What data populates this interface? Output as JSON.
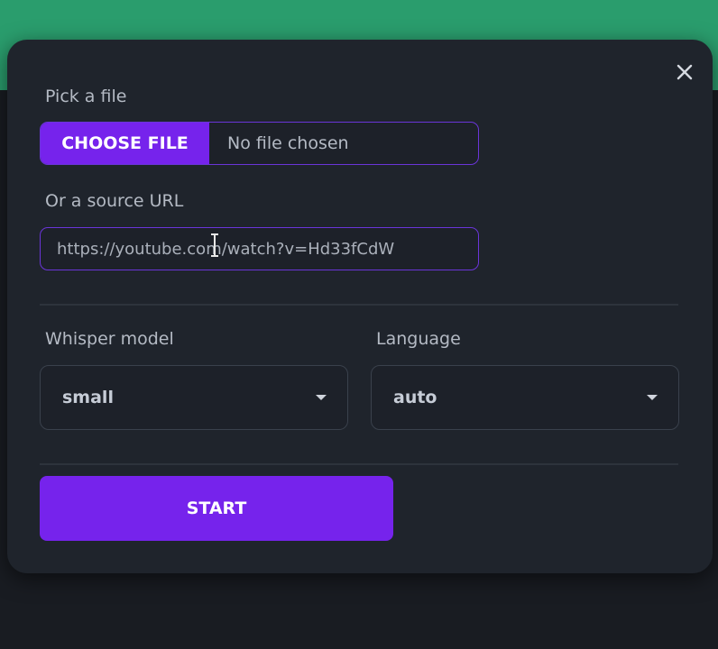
{
  "modal": {
    "file_label": "Pick a file",
    "choose_file_label": "CHOOSE FILE",
    "file_status": "No file chosen",
    "url_label": "Or a source URL",
    "url_value": "https://youtube.com/watch?v=Hd33fCdW",
    "model_label": "Whisper model",
    "model_value": "small",
    "language_label": "Language",
    "language_value": "auto",
    "start_label": "START"
  },
  "icons": {
    "close": "close-icon",
    "dropdown": "chevron-down-icon",
    "cursor": "text-cursor-icon"
  },
  "colors": {
    "accent": "#7623ec",
    "background_band": "#2a9d6d",
    "modal_bg": "#1f242c"
  }
}
